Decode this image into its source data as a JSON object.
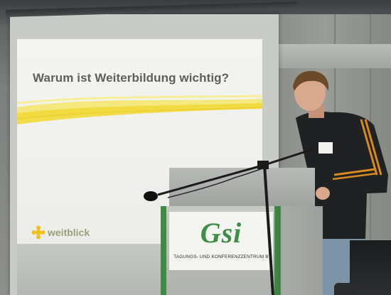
{
  "slide": {
    "title": "Warum ist Weiterbildung wichtig?",
    "logo_text": "weitblick",
    "accent_color": "#f2d93a"
  },
  "lectern_sign": {
    "logo": "Gsi",
    "caption": "TAGUNGS- UND KONFERENZZENTRUM B",
    "brand_color": "#3f8e47"
  }
}
